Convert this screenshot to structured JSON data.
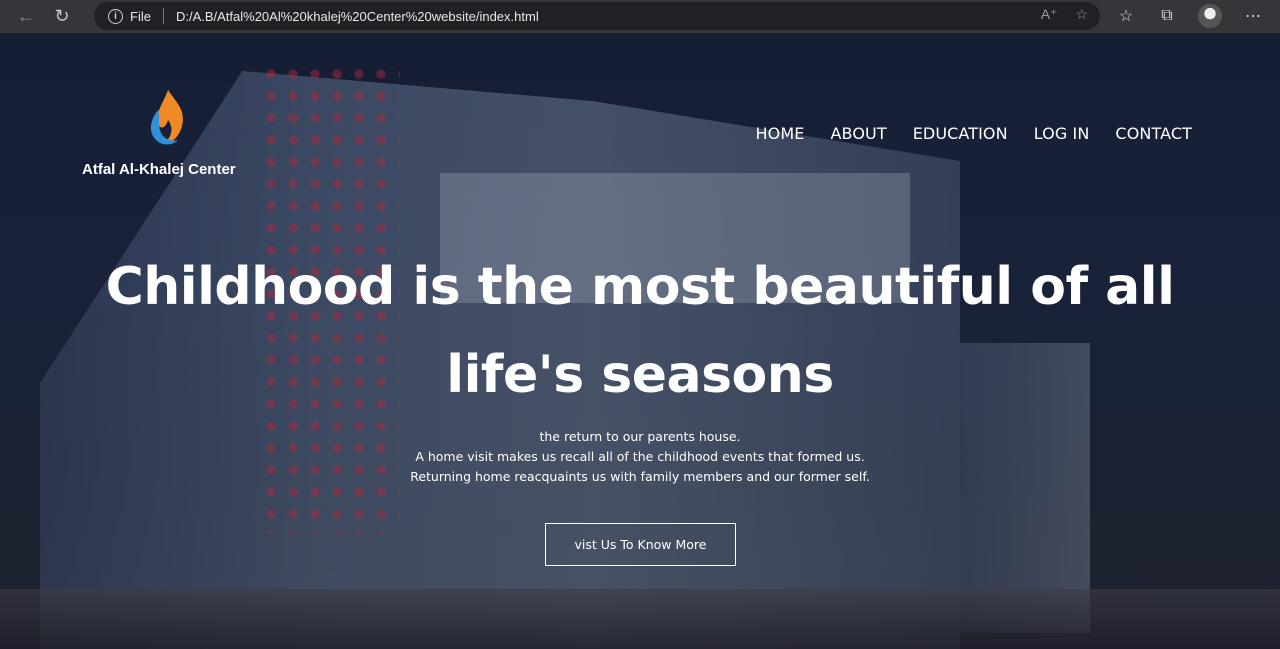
{
  "browser": {
    "address_scheme": "File",
    "address_url": "D:/A.B/Atfal%20Al%20khalej%20Center%20website/index.html",
    "icons": [
      "back-icon",
      "reload-icon",
      "info-icon",
      "read-aloud-icon",
      "add-favorite-icon",
      "favorites-icon",
      "collections-icon",
      "profile-avatar",
      "more-icon"
    ]
  },
  "site": {
    "logo_text": "Atfal Al-Khalej Center",
    "nav": [
      "HOME",
      "ABOUT",
      "EDUCATION",
      "LOG IN",
      "CONTACT"
    ],
    "headline_line1": "Childhood is the most beautiful of all",
    "headline_line2": "life's seasons",
    "sub_line1": "the return to our parents house.",
    "sub_line2": "A home visit makes us recall all of the childhood events that formed us.",
    "sub_line3": "Returning home reacquaints us with family members and our former self.",
    "cta_label": "vist Us To Know More"
  },
  "colors": {
    "logo_flame_orange": "#f08a24",
    "logo_flame_blue": "#2f8fd8",
    "overlay": "#12182d"
  }
}
